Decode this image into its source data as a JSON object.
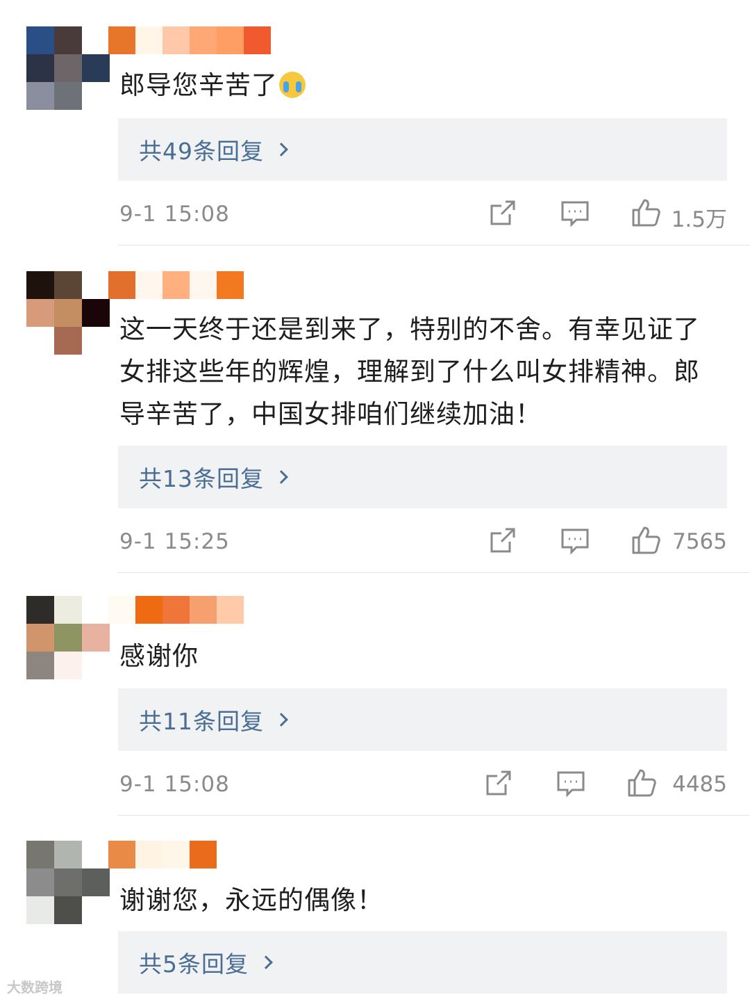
{
  "comments": [
    {
      "text": "郎导您辛苦了",
      "emoji": "crying-face",
      "replies_label": "共49条回复",
      "time": "9-1 15:08",
      "likes": "1.5万",
      "avatar_colors": [
        "#2a4f86",
        "#4a3b3b",
        "#ffffff",
        "#2d3346",
        "#6e6568",
        "#2a3b57",
        "#8b8e9f",
        "#6e7178",
        "#ffffff"
      ],
      "name_colors": [
        "#e8762a",
        "#fff6e8",
        "#ffc8a8",
        "#ffa876",
        "#ff9e62",
        "#f05a2e"
      ]
    },
    {
      "text": "这一天终于还是到来了，特别的不舍。有幸见证了女排这些年的辉煌，理解到了什么叫女排精神。郎导辛苦了，中国女排咱们继续加油！",
      "replies_label": "共13条回复",
      "time": "9-1 15:25",
      "likes": "7565",
      "avatar_colors": [
        "#1e120d",
        "#5b4535",
        "#ffffff",
        "#d79a7b",
        "#c58d62",
        "#1a0608",
        "#ffffff",
        "#a66a52",
        "#ffffff"
      ],
      "name_colors": [
        "#e36f2c",
        "#fff7ee",
        "#ffb07e",
        "#fff7ee",
        "#f27920",
        "#ffffff"
      ]
    },
    {
      "text": "感谢你",
      "replies_label": "共11条回复",
      "time": "9-1 15:08",
      "likes": "4485",
      "avatar_colors": [
        "#2e2c29",
        "#ecece0",
        "#ffffff",
        "#d0956a",
        "#8e9462",
        "#e8b2a0",
        "#8d857f",
        "#fdf1ee",
        "#ffffff"
      ],
      "name_colors": [
        "#fffaf2",
        "#f06a12",
        "#ef7638",
        "#f6a070",
        "#ffcaa8",
        "#ffffff"
      ]
    },
    {
      "text": "谢谢您，永远的偶像！",
      "replies_label": "共5条回复",
      "avatar_colors": [
        "#77776f",
        "#b1b5b0",
        "#ffffff",
        "#8c8c8c",
        "#6e6f6d",
        "#5d5f5c",
        "#e8eae8",
        "#4e4f4a",
        "#ffffff"
      ],
      "name_colors": [
        "#ea8a47",
        "#fff3e3",
        "#fff6ea",
        "#ea6b1c",
        "#ffffff",
        "#ffffff"
      ]
    }
  ],
  "watermark": "大数跨境",
  "colors": {
    "link_blue": "#4a6d94",
    "meta_gray": "#8a8a8a",
    "reply_bg": "#f1f2f4"
  }
}
